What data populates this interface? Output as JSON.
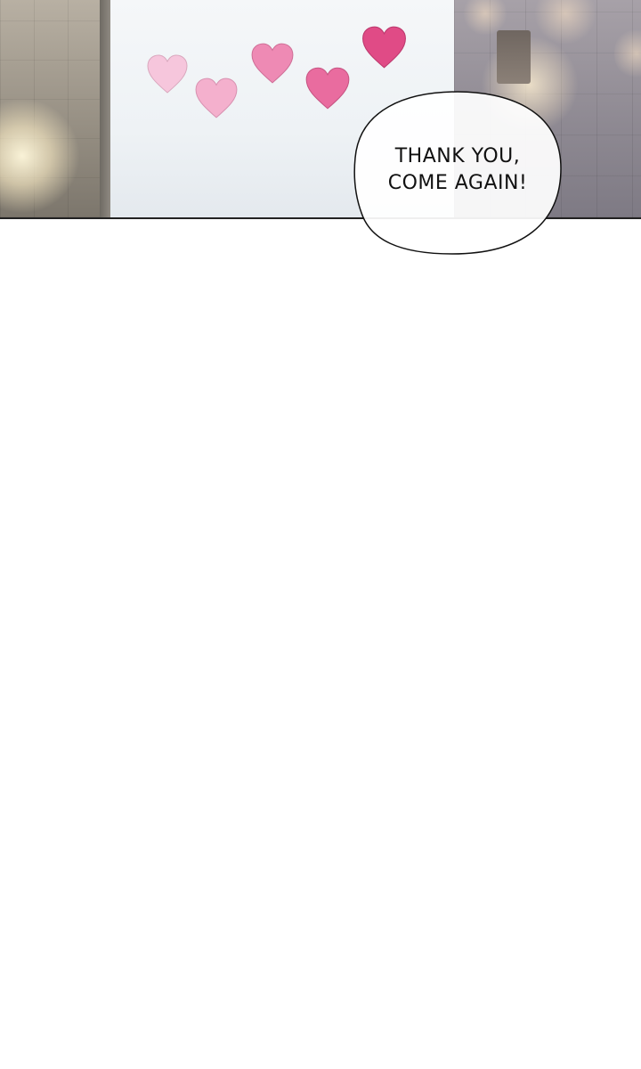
{
  "speech_bubble": {
    "line1": "THANK YOU,",
    "line2": "COME AGAIN!"
  },
  "colors": {
    "heart_1": "#f6c6dc",
    "heart_2": "#f4b0cd",
    "heart_3": "#ee8ab4",
    "heart_4": "#e96c9f",
    "heart_5": "#e04b86",
    "panel_border": "#222222",
    "page_background": "#ffffff"
  }
}
